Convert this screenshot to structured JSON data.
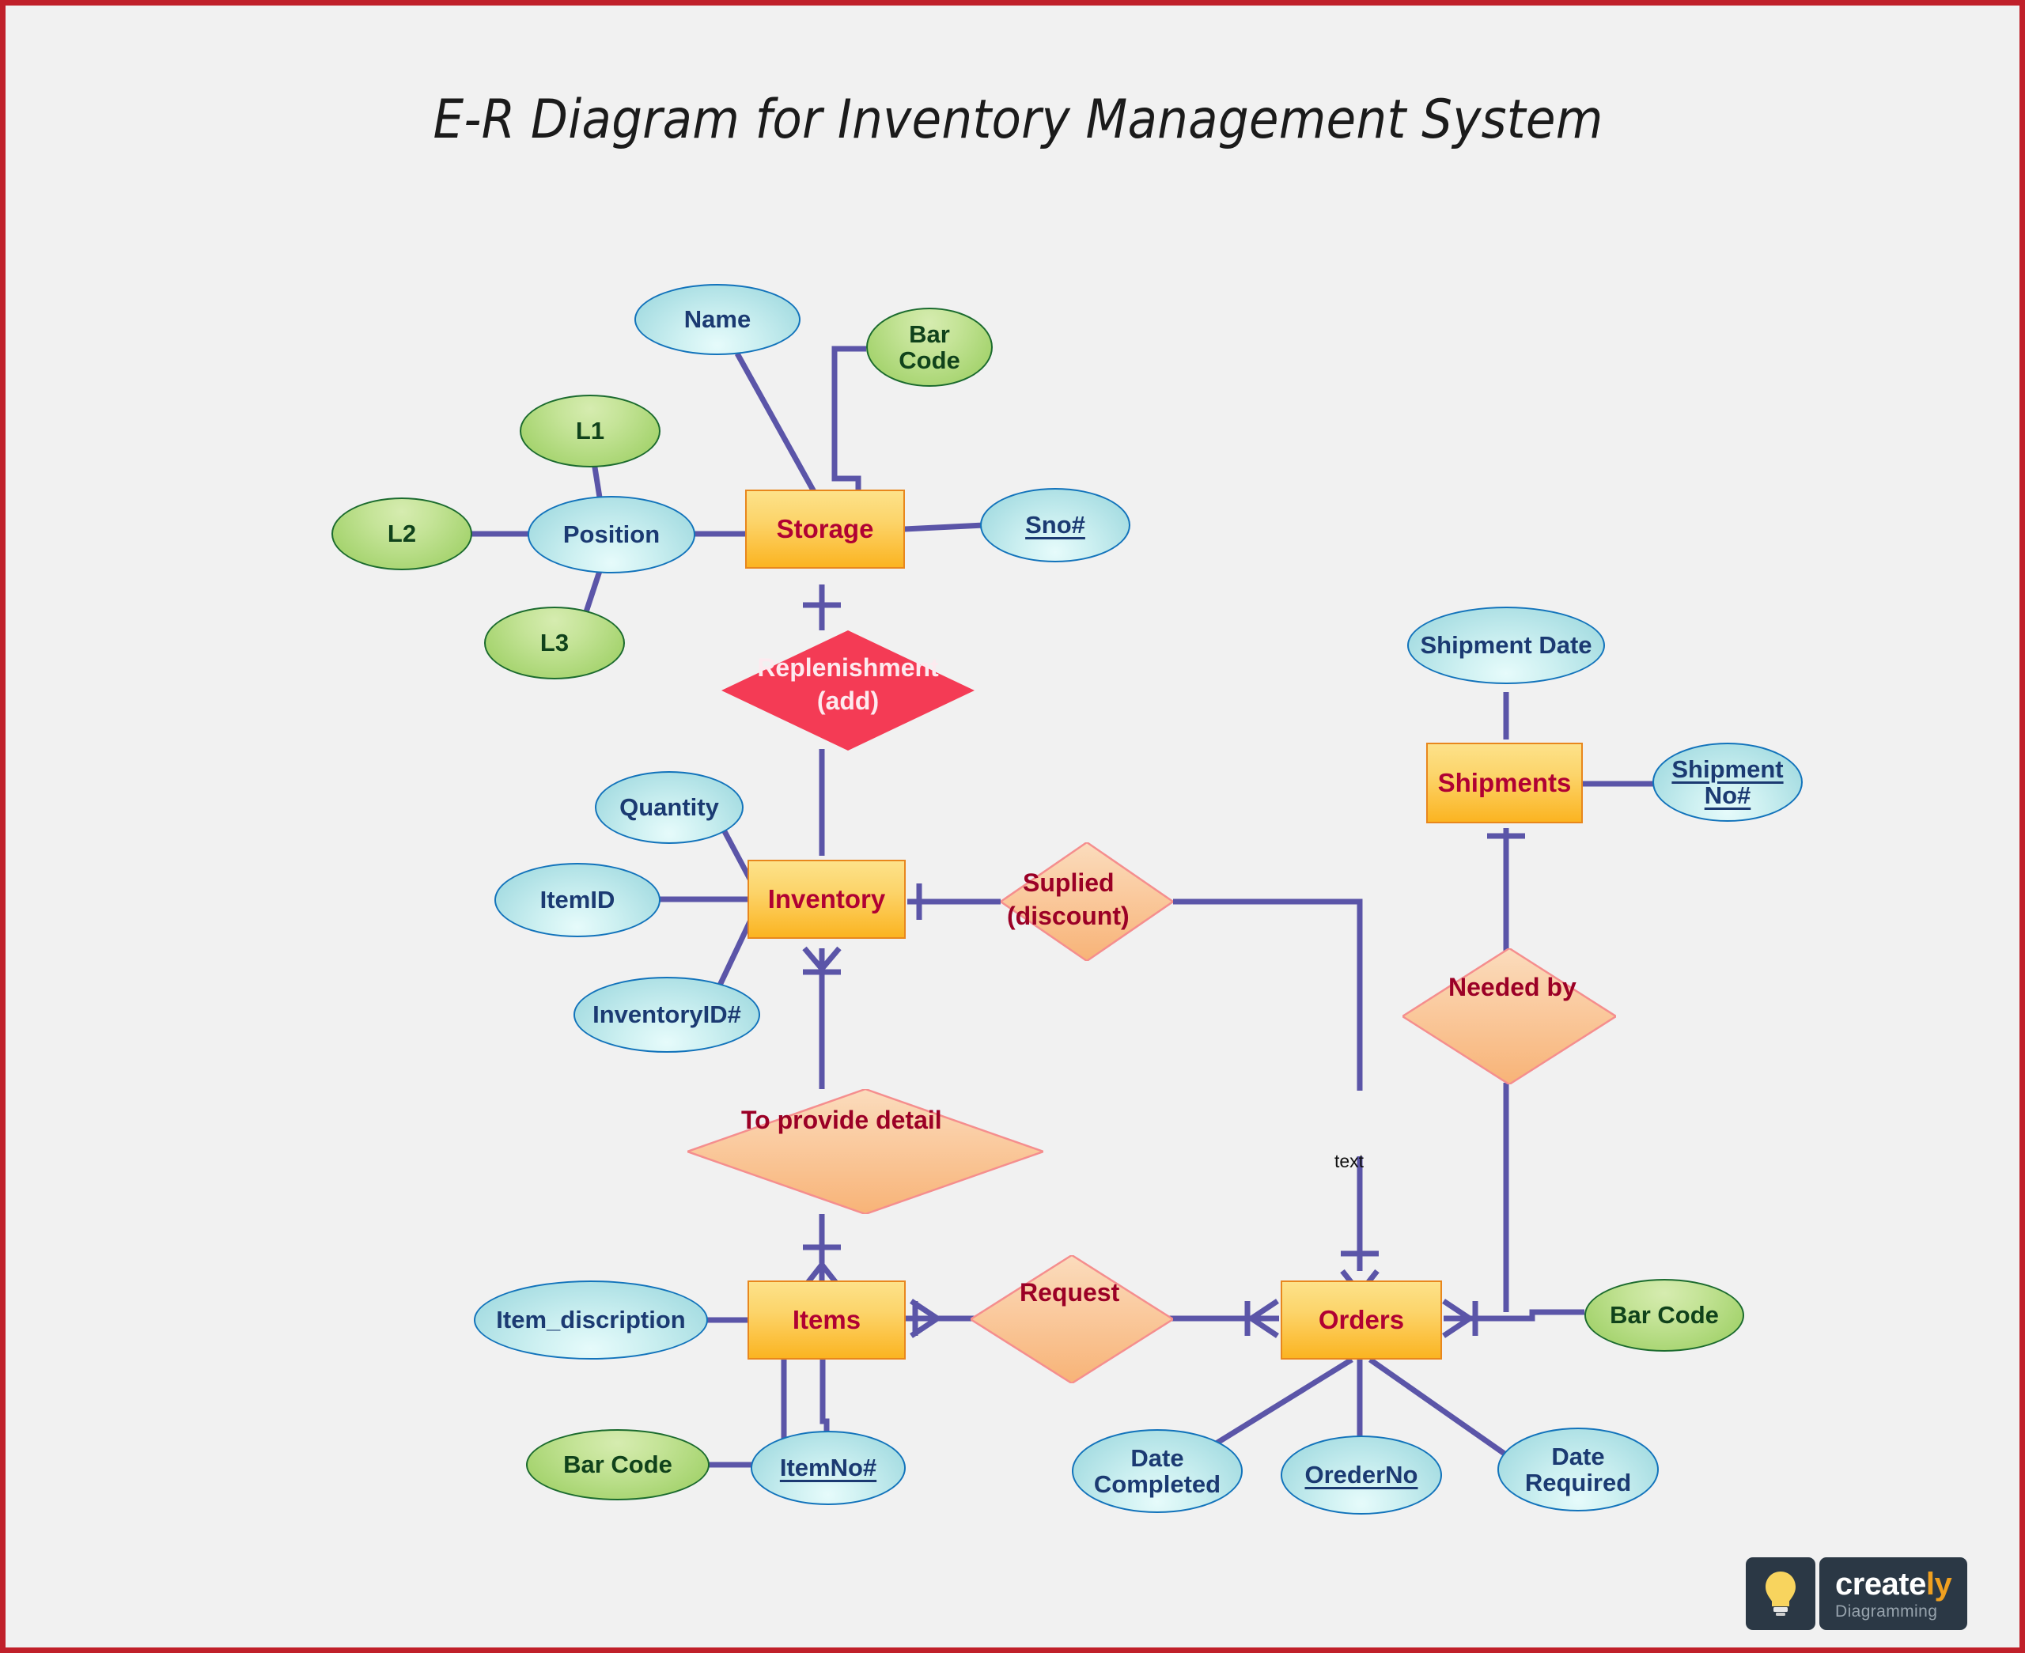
{
  "page": {
    "title": "E-R Diagram for Inventory Management System",
    "background_color": "#f1f1f1",
    "border_color": "#c0202a"
  },
  "colors": {
    "entity_fill": "#fbb421",
    "entity_border": "#e8871d",
    "entity_text": "#b00133",
    "attribute_fill": "#a9dee3",
    "attribute_border": "#1273bb",
    "attribute_text": "#1b3a72",
    "attribute_green_fill": "#a8d572",
    "attribute_green_border": "#1b6b2e",
    "attribute_green_text": "#10421b",
    "relationship_fill": "#f8bb84",
    "relationship_border": "#f49a9a",
    "relationship_text": "#9b0026",
    "relationship_red_fill": "#f43b55",
    "relationship_red_text": "#fdeaef",
    "connector": "#5b55a8"
  },
  "entities": [
    {
      "id": "storage",
      "label": "Storage"
    },
    {
      "id": "inventory",
      "label": "Inventory"
    },
    {
      "id": "items",
      "label": "Items"
    },
    {
      "id": "orders",
      "label": "Orders"
    },
    {
      "id": "shipments",
      "label": "Shipments"
    }
  ],
  "attributes": [
    {
      "id": "name",
      "label": "Name",
      "kind": "cyan",
      "key": false,
      "owner": "storage"
    },
    {
      "id": "bar_code_storage",
      "label": "Bar\nCode",
      "line1": "Bar",
      "line2": "Code",
      "kind": "green",
      "key": false,
      "owner": "storage"
    },
    {
      "id": "sno",
      "label": "Sno#",
      "kind": "cyan",
      "key": true,
      "owner": "storage"
    },
    {
      "id": "position",
      "label": "Position",
      "kind": "cyan",
      "key": false,
      "owner": "storage"
    },
    {
      "id": "l1",
      "label": "L1",
      "kind": "green",
      "key": false,
      "owner": "position"
    },
    {
      "id": "l2",
      "label": "L2",
      "kind": "green",
      "key": false,
      "owner": "position"
    },
    {
      "id": "l3",
      "label": "L3",
      "kind": "green",
      "key": false,
      "owner": "position"
    },
    {
      "id": "quantity",
      "label": "Quantity",
      "kind": "cyan",
      "key": false,
      "owner": "inventory"
    },
    {
      "id": "itemid",
      "label": "ItemID",
      "kind": "cyan",
      "key": false,
      "owner": "inventory"
    },
    {
      "id": "inventoryid",
      "label": "InventoryID#",
      "kind": "cyan",
      "key": false,
      "owner": "inventory"
    },
    {
      "id": "item_discription",
      "label": "Item_discription",
      "kind": "cyan",
      "key": false,
      "owner": "items"
    },
    {
      "id": "itemno",
      "label": "ItemNo#",
      "kind": "cyan",
      "key": true,
      "owner": "items"
    },
    {
      "id": "bar_code_items",
      "label": "Bar Code",
      "kind": "green",
      "key": false,
      "owner": "itemno"
    },
    {
      "id": "date_completed",
      "label": "Date\nCompleted",
      "line1": "Date",
      "line2": "Completed",
      "kind": "cyan",
      "key": false,
      "owner": "orders"
    },
    {
      "id": "orederno",
      "label": "OrederNo",
      "kind": "cyan",
      "key": true,
      "owner": "orders"
    },
    {
      "id": "date_required",
      "label": "Date\nRequired",
      "line1": "Date",
      "line2": "Required",
      "kind": "cyan",
      "key": false,
      "owner": "orders"
    },
    {
      "id": "bar_code_orders",
      "label": "Bar Code",
      "kind": "green",
      "key": false,
      "owner": "orders"
    },
    {
      "id": "shipment_date",
      "label": "Shipment Date",
      "kind": "cyan",
      "key": false,
      "owner": "shipments"
    },
    {
      "id": "shipment_no",
      "label": "Shipment\nNo#",
      "line1": "Shipment",
      "line2": "No#",
      "kind": "cyan",
      "key": true,
      "owner": "shipments"
    }
  ],
  "relationships": [
    {
      "id": "replenishment",
      "line1": "Replenishment",
      "line2": "(add)",
      "style": "red",
      "from": "storage",
      "to": "inventory"
    },
    {
      "id": "suplied",
      "line1": "Suplied",
      "line2": "(discount)",
      "style": "peach",
      "from": "inventory",
      "to": "orders"
    },
    {
      "id": "to_provide",
      "line1": "To provide detail",
      "line2": "",
      "style": "peach",
      "from": "inventory",
      "to": "items"
    },
    {
      "id": "request",
      "line1": "Request",
      "line2": "",
      "style": "peach",
      "from": "items",
      "to": "orders"
    },
    {
      "id": "needed_by",
      "line1": "Needed by",
      "line2": "",
      "style": "peach",
      "from": "shipments",
      "to": "orders"
    }
  ],
  "edge_labels": [
    {
      "id": "text_label",
      "label": "text"
    }
  ],
  "logo": {
    "word_main": "create",
    "word_accent": "ly",
    "tagline": "Diagramming",
    "icon": "lightbulb-icon"
  }
}
